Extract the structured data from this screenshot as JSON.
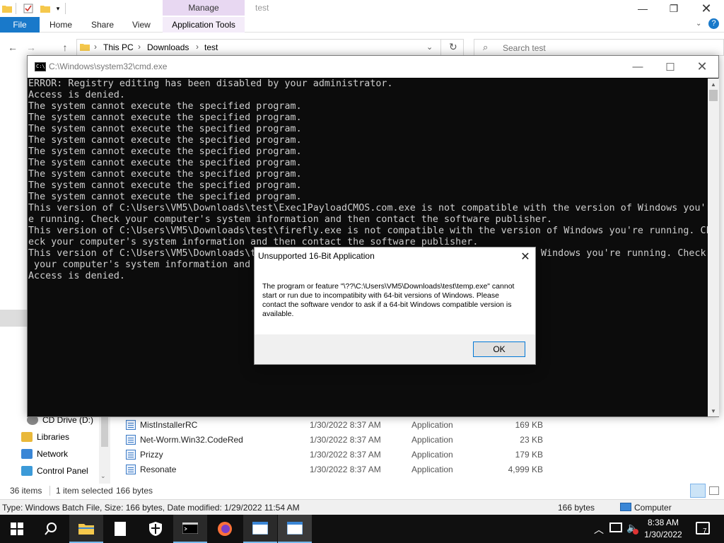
{
  "explorer": {
    "window_title": "test",
    "manage_label": "Manage",
    "tabs": {
      "file": "File",
      "home": "Home",
      "share": "Share",
      "view": "View",
      "app_tools": "Application Tools"
    },
    "breadcrumb": [
      "This PC",
      "Downloads",
      "test"
    ],
    "search_placeholder": "Search test",
    "nav_items": [
      {
        "label": "CD Drive (D:)",
        "icon": "cd-drive-icon"
      },
      {
        "label": "Libraries",
        "icon": "libraries-icon"
      },
      {
        "label": "Network",
        "icon": "network-icon"
      },
      {
        "label": "Control Panel",
        "icon": "control-panel-icon"
      }
    ],
    "files": [
      {
        "name": "MistInstallerRC",
        "date": "1/30/2022 8:37 AM",
        "type": "Application",
        "size": "169 KB"
      },
      {
        "name": "Net-Worm.Win32.CodeRed",
        "date": "1/30/2022 8:37 AM",
        "type": "Application",
        "size": "23 KB"
      },
      {
        "name": "Prizzy",
        "date": "1/30/2022 8:37 AM",
        "type": "Application",
        "size": "179 KB"
      },
      {
        "name": "Resonate",
        "date": "1/30/2022 8:37 AM",
        "type": "Application",
        "size": "4,999 KB"
      }
    ],
    "status": {
      "items": "36 items",
      "selected": "1 item selected",
      "selected_size": "166 bytes"
    },
    "details": {
      "text": "Type: Windows Batch File, Size: 166 bytes, Date modified: 1/29/2022 11:54 AM",
      "size": "166 bytes",
      "location": "Computer"
    }
  },
  "cmd": {
    "title": "C:\\Windows\\system32\\cmd.exe",
    "lines": [
      "ERROR: Registry editing has been disabled by your administrator.",
      "Access is denied.",
      "The system cannot execute the specified program.",
      "The system cannot execute the specified program.",
      "The system cannot execute the specified program.",
      "The system cannot execute the specified program.",
      "The system cannot execute the specified program.",
      "The system cannot execute the specified program.",
      "The system cannot execute the specified program.",
      "The system cannot execute the specified program.",
      "The system cannot execute the specified program.",
      "This version of C:\\Users\\VM5\\Downloads\\test\\Exec1PayloadCMOS.com.exe is not compatible with the version of Windows you'r",
      "e running. Check your computer's system information and then contact the software publisher.",
      "This version of C:\\Users\\VM5\\Downloads\\test\\firefly.exe is not compatible with the version of Windows you're running. Ch",
      "eck your computer's system information and then contact the software publisher.",
      "This version of C:\\Users\\VM5\\Downloads\\t                                                  Windows you're running. Check",
      " your computer's system information and",
      "Access is denied."
    ]
  },
  "dialog": {
    "title": "Unsupported 16-Bit Application",
    "message": "The program or feature \"\\??\\C:\\Users\\VM5\\Downloads\\test\\temp.exe\" cannot start or run due to incompatibity with 64-bit versions of Windows. Please contact the software vendor to ask if a 64-bit Windows compatible version is available.",
    "ok_label": "OK"
  },
  "taskbar": {
    "time": "8:38 AM",
    "date": "1/30/2022",
    "notification_count": "7"
  }
}
